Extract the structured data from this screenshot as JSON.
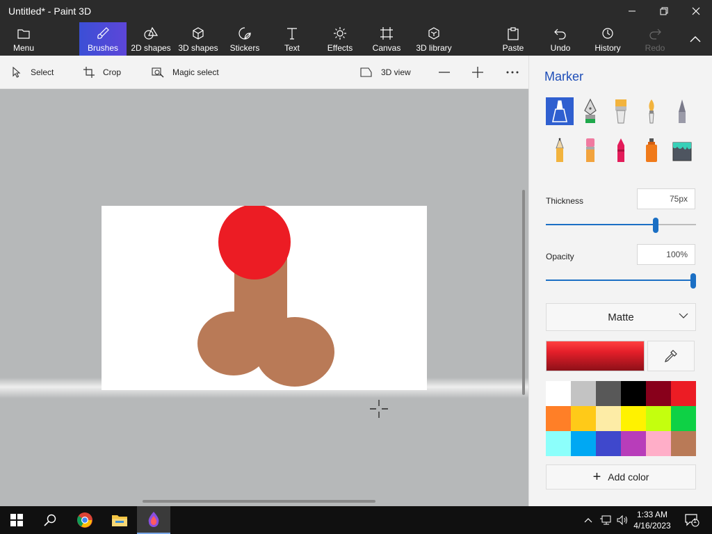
{
  "window": {
    "title": "Untitled* - Paint 3D"
  },
  "ribbon": {
    "items": [
      {
        "label": "Menu",
        "icon": "folder-icon"
      },
      {
        "label": "Brushes",
        "icon": "brush-icon",
        "active": true
      },
      {
        "label": "2D shapes",
        "icon": "shapes-2d-icon"
      },
      {
        "label": "3D shapes",
        "icon": "cube-icon"
      },
      {
        "label": "Stickers",
        "icon": "sticker-icon"
      },
      {
        "label": "Text",
        "icon": "text-icon"
      },
      {
        "label": "Effects",
        "icon": "sun-icon"
      },
      {
        "label": "Canvas",
        "icon": "canvas-icon"
      },
      {
        "label": "3D library",
        "icon": "library-icon"
      },
      {
        "label": "Paste",
        "icon": "clipboard-icon"
      },
      {
        "label": "Undo",
        "icon": "undo-icon"
      },
      {
        "label": "History",
        "icon": "history-icon"
      },
      {
        "label": "Redo",
        "icon": "redo-icon",
        "disabled": true
      }
    ]
  },
  "toolbar": {
    "select": "Select",
    "crop": "Crop",
    "magic_select": "Magic select",
    "view3d": "3D view"
  },
  "panel": {
    "title": "Marker",
    "thickness_label": "Thickness",
    "thickness_value": "75px",
    "thickness_fraction": 0.73,
    "opacity_label": "Opacity",
    "opacity_value": "100%",
    "opacity_fraction": 1.0,
    "finish": "Matte",
    "add_color": "Add color",
    "current_color": "#e51f2a",
    "palette": [
      "#ffffff",
      "#c3c3c3",
      "#585858",
      "#000000",
      "#88001b",
      "#ec1c24",
      "#ff7f27",
      "#ffca18",
      "#fdeca6",
      "#fff200",
      "#c4ff0e",
      "#0ed145",
      "#8cfffb",
      "#00a8f3",
      "#3f48cc",
      "#b83dba",
      "#ffaec8",
      "#b97a57"
    ]
  },
  "drawing": {
    "head_color": "#ec1c24",
    "body_color": "#b97a57"
  },
  "taskbar": {
    "time": "1:33 AM",
    "date": "4/16/2023",
    "notifications": "1"
  }
}
